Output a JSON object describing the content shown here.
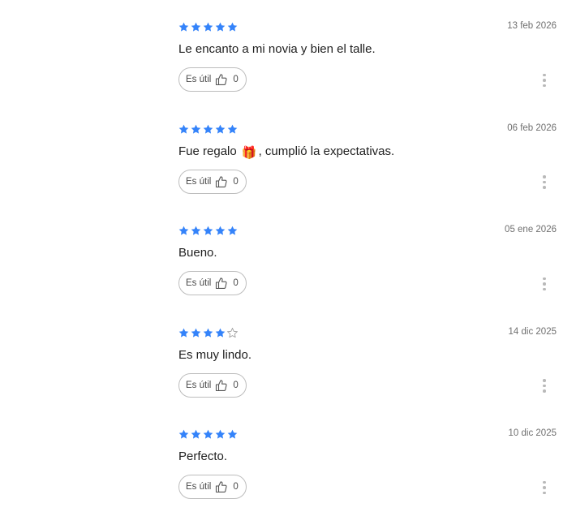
{
  "colors": {
    "star_filled": "#3483fa",
    "star_empty": "#9e9e9e",
    "date_text": "#6f6f6f",
    "button_border": "#bdbdbd",
    "kebab_dots": "#b9b9b9"
  },
  "icons": {
    "rating": "star-icon",
    "useful": "thumbs-up-icon",
    "menu": "kebab-menu-icon",
    "gift": "gift-emoji"
  },
  "reviews": [
    {
      "rating": 5,
      "max_rating": 5,
      "date": "13 feb 2026",
      "text": "Le encanto a mi novia y bien el talle.",
      "useful_label": "Es útil",
      "useful_count": "0"
    },
    {
      "rating": 5,
      "max_rating": 5,
      "date": "06 feb 2026",
      "text_before_emoji": "Fue regalo",
      "emoji": "🎁",
      "text_after_emoji": ", cumplió la expectativas.",
      "useful_label": "Es útil",
      "useful_count": "0"
    },
    {
      "rating": 5,
      "max_rating": 5,
      "date": "05 ene 2026",
      "text": "Bueno.",
      "useful_label": "Es útil",
      "useful_count": "0"
    },
    {
      "rating": 4,
      "max_rating": 5,
      "date": "14 dic 2025",
      "text": "Es muy lindo.",
      "useful_label": "Es útil",
      "useful_count": "0"
    },
    {
      "rating": 5,
      "max_rating": 5,
      "date": "10 dic 2025",
      "text": "Perfecto.",
      "useful_label": "Es útil",
      "useful_count": "0"
    }
  ]
}
